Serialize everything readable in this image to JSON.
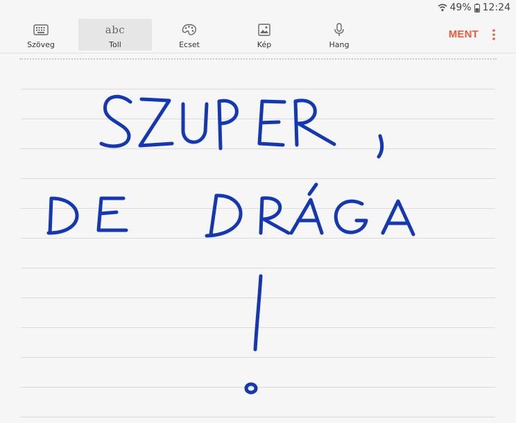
{
  "status": {
    "battery": "49%",
    "time": "12:24",
    "icons": [
      "wifi-icon",
      "battery-icon"
    ]
  },
  "toolbar": {
    "tools": [
      {
        "label": "Szöveg",
        "icon": "keyboard-icon",
        "active": false
      },
      {
        "label": "Toll",
        "icon": "pen-abc-icon",
        "glyph": "abc",
        "active": true
      },
      {
        "label": "Ecset",
        "icon": "palette-icon",
        "active": false
      },
      {
        "label": "Kép",
        "icon": "image-icon",
        "active": false
      },
      {
        "label": "Hang",
        "icon": "microphone-icon",
        "active": false
      }
    ],
    "save_label": "MENT",
    "more_icon": "more-vert-icon"
  },
  "colors": {
    "accent": "#ec5b3a",
    "ink": "#1237b8",
    "background": "#f6f6f6",
    "rule": "#dadada"
  },
  "note": {
    "handwriting": [
      "SZUPER,",
      "DE DRÁGA",
      "!"
    ]
  }
}
